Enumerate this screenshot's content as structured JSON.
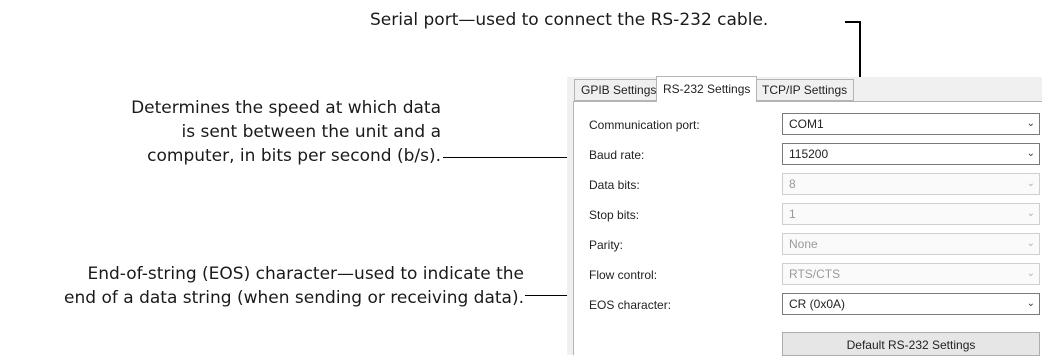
{
  "callouts": {
    "serial_port": "Serial port—used to connect the RS-232 cable.",
    "baud_line1": "Determines the speed at which data",
    "baud_line2": "is sent between the unit and a",
    "baud_line3": "computer, in bits per second (b/s).",
    "eos_line1": "End-of-string (EOS) character—used to indicate the",
    "eos_line2": "end of a data string (when sending or receiving data)."
  },
  "tabs": [
    {
      "label": "GPIB Settings",
      "active": false
    },
    {
      "label": "RS-232 Settings",
      "active": true
    },
    {
      "label": "TCP/IP Settings",
      "active": false
    }
  ],
  "fields": [
    {
      "label": "Communication port:",
      "value": "COM1",
      "enabled": true
    },
    {
      "label": "Baud rate:",
      "value": "115200",
      "enabled": true
    },
    {
      "label": "Data bits:",
      "value": "8",
      "enabled": false
    },
    {
      "label": "Stop bits:",
      "value": "1",
      "enabled": false
    },
    {
      "label": "Parity:",
      "value": "None",
      "enabled": false
    },
    {
      "label": "Flow control:",
      "value": "RTS/CTS",
      "enabled": false
    },
    {
      "label": "EOS character:",
      "value": "CR (0x0A)",
      "enabled": true
    }
  ],
  "default_button_label": "Default RS-232 Settings",
  "icons": {
    "dropdown": "chevron-down-icon"
  }
}
